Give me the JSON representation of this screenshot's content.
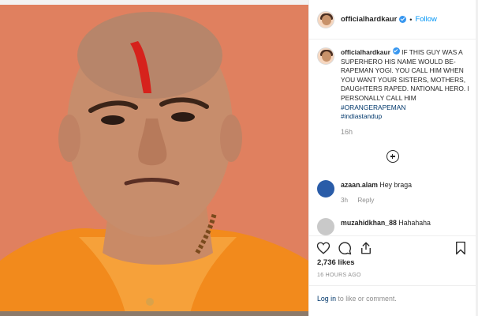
{
  "header": {
    "username": "officialhardkaur",
    "separator": "•",
    "follow_label": "Follow"
  },
  "caption": {
    "username": "officialhardkaur",
    "text": "IF THIS GUY WAS A SUPERHERO HIS NAME WOULD BE- RAPEMAN YOGI. YOU CALL HIM WHEN YOU WANT YOUR SISTERS, MOTHERS, DAUGHTERS RAPED. NATIONAL HERO. I PERSONALLY CALL HIM",
    "hashtags": [
      "#ORANGERAPEMAN",
      "#indiastandup"
    ],
    "time": "16h"
  },
  "comments": [
    {
      "username": "azaan.alam",
      "text": "Hey braga",
      "time": "3h",
      "reply_label": "Reply",
      "avatar_color": "#2a5ca8"
    },
    {
      "username": "muzahidkhan_88",
      "text": "Hahahaha",
      "avatar_color": "#c9c9c9"
    }
  ],
  "actions": {
    "likes": "2,736 likes",
    "post_time": "16 HOURS AGO",
    "login_link": "Log in",
    "login_rest": " to like or comment."
  },
  "icons": [
    "heart-icon",
    "comment-icon",
    "share-icon",
    "bookmark-icon",
    "plus-circle-icon",
    "verified-badge-icon"
  ],
  "colors": {
    "photo_background": "#e0805f",
    "link_blue": "#0095f6",
    "hashtag": "#00376b",
    "verified": "#3897f0"
  }
}
